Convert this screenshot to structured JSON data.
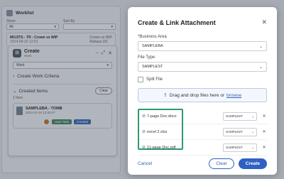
{
  "worklist": {
    "title": "Worklist",
    "show_label": "Show",
    "show_value": "All",
    "sort_label": "Sort By",
    "row1_left": "MOJITS - TR - Crown vs WIP",
    "row1_date": "2024-08-22  12:01",
    "row1_right": "Crown vs WIP",
    "row1_right_sub": "Rahaus DC"
  },
  "create_panel": {
    "title": "Create",
    "subtitle": "Work",
    "select_value": "Work",
    "section_create": "Create Work Criteria",
    "section_created": "Created Items",
    "count": "1 Item",
    "clear_label": "Clear",
    "item_name": "SAMPLEBA - TOMB",
    "item_date": "2024-10-18  12:05:57",
    "tag_user": "User Task",
    "tag_status": "Created"
  },
  "modal": {
    "title": "Create & Link Attachment",
    "business_area_label": "*Business Area",
    "business_area_value": "SAMPLEBA",
    "file_type_label": "File Type",
    "file_type_value": "SAMPLEST",
    "split_label": "Split File",
    "drop_text": "Drag and drop files here or",
    "browse_text": "browse",
    "files": [
      {
        "name": "7-page Doc.docx",
        "type": "SAMPLEST"
      },
      {
        "name": "excel 2.xlsx",
        "type": "SAMPLEST"
      },
      {
        "name": "11-page Doc.pdf",
        "type": "SAMPLEST"
      }
    ],
    "cancel_label": "Cancel",
    "clear_label": "Clear",
    "create_label": "Create"
  },
  "colors": {
    "primary": "#2f61c4",
    "highlight": "#2e9a6a"
  }
}
